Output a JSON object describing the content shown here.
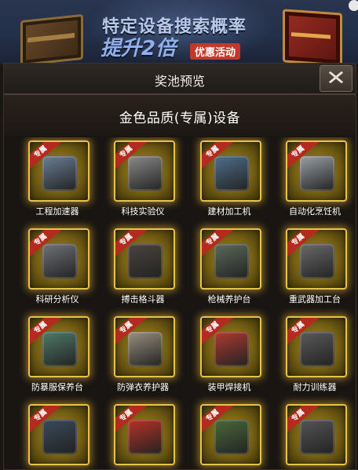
{
  "banner": {
    "title": "特定设备搜索概率",
    "big": "提升2倍",
    "tag": "优惠活动"
  },
  "modal": {
    "title": "奖池预览",
    "close_glyph": "✕",
    "section_title": "金色品质(专属)设备",
    "ribbon_text": "专属",
    "items": [
      {
        "label": "工程加速器",
        "icon": "engineering-accelerator-icon",
        "color": "#6a7f96"
      },
      {
        "label": "科技实验仪",
        "icon": "tech-lab-instrument-icon",
        "color": "#8a8a8a"
      },
      {
        "label": "建材加工机",
        "icon": "building-material-processor-icon",
        "color": "#4f6f8c"
      },
      {
        "label": "自动化烹饪机",
        "icon": "auto-cooking-machine-icon",
        "color": "#9aa0a6"
      },
      {
        "label": "科研分析仪",
        "icon": "research-analyzer-icon",
        "color": "#6e7278"
      },
      {
        "label": "搏击格斗器",
        "icon": "combat-training-dummy-icon",
        "color": "#4a4440"
      },
      {
        "label": "枪械养护台",
        "icon": "gun-maintenance-table-icon",
        "color": "#5c6a5a"
      },
      {
        "label": "重武器加工台",
        "icon": "heavy-weapon-workbench-icon",
        "color": "#6a6a6a"
      },
      {
        "label": "防暴服保养台",
        "icon": "riot-suit-maintenance-icon",
        "color": "#4f7a6a"
      },
      {
        "label": "防弹衣养护器",
        "icon": "bulletproof-vest-care-icon",
        "color": "#9a9080"
      },
      {
        "label": "装甲焊接机",
        "icon": "armor-welder-icon",
        "color": "#b03a30"
      },
      {
        "label": "耐力训练器",
        "icon": "treadmill-icon",
        "color": "#5a5a5a"
      },
      {
        "label": "",
        "icon": "monitor-console-icon",
        "color": "#3a4a5a"
      },
      {
        "label": "",
        "icon": "fuel-pump-icon",
        "color": "#b83228"
      },
      {
        "label": "",
        "icon": "military-tent-icon",
        "color": "#4a6a3a"
      },
      {
        "label": "",
        "icon": "reclining-chair-icon",
        "color": "#555555"
      }
    ]
  }
}
